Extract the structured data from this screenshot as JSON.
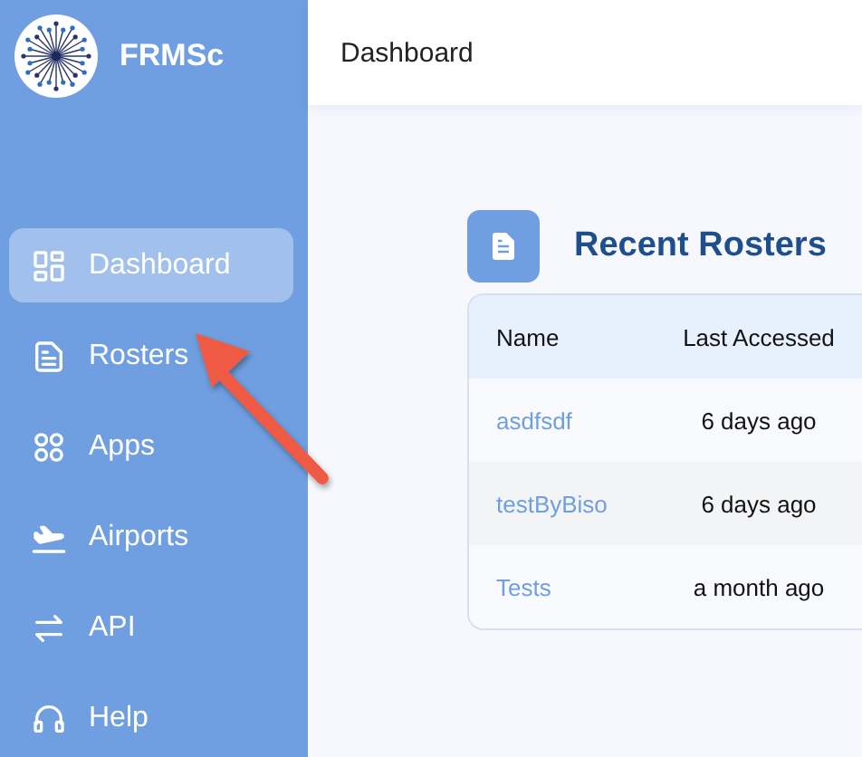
{
  "app": {
    "name": "FRMSc"
  },
  "sidebar": {
    "items": [
      {
        "label": "Dashboard",
        "selected": true
      },
      {
        "label": "Rosters",
        "selected": false
      },
      {
        "label": "Apps",
        "selected": false
      },
      {
        "label": "Airports",
        "selected": false
      },
      {
        "label": "API",
        "selected": false
      },
      {
        "label": "Help",
        "selected": false
      }
    ]
  },
  "header": {
    "title": "Dashboard"
  },
  "recent_rosters": {
    "title": "Recent Rosters",
    "columns": [
      "Name",
      "Last Accessed"
    ],
    "rows": [
      {
        "name": "asdfsdf",
        "last_accessed": "6 days ago"
      },
      {
        "name": "testByBiso",
        "last_accessed": "6 days ago"
      },
      {
        "name": "Tests",
        "last_accessed": "a month ago"
      }
    ]
  }
}
